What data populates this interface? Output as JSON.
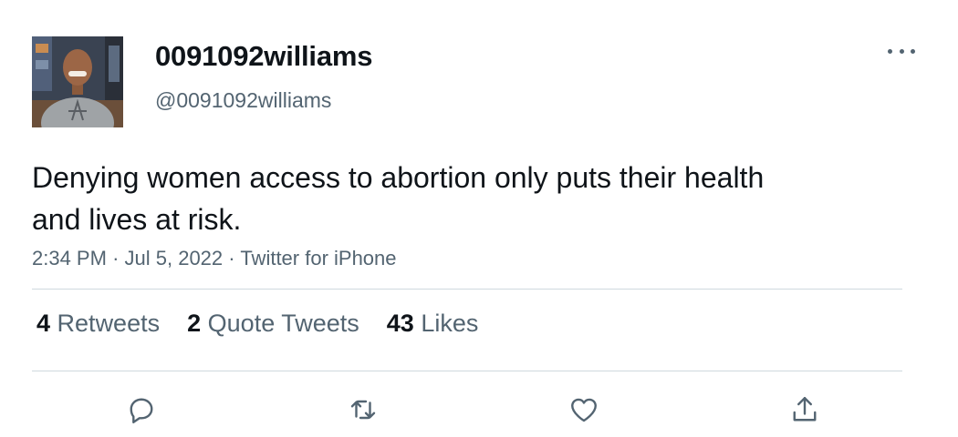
{
  "tweet": {
    "author": {
      "display_name": "0091092williams",
      "handle": "@0091092williams"
    },
    "text": "Denying women access to abortion only puts their health and lives at risk.",
    "time": "2:34 PM",
    "date": "Jul 5, 2022",
    "source": "Twitter for iPhone",
    "separator": "·"
  },
  "stats": {
    "retweets_count": "4",
    "retweets_label": "Retweets",
    "quotes_count": "2",
    "quotes_label": "Quote Tweets",
    "likes_count": "43",
    "likes_label": "Likes"
  },
  "icons": {
    "more": "more-horizontal-icon",
    "reply": "reply-icon",
    "retweet": "retweet-icon",
    "like": "heart-icon",
    "share": "share-icon"
  },
  "colors": {
    "text_primary": "#0f1419",
    "text_secondary": "#536471",
    "divider": "#cfd9de"
  }
}
